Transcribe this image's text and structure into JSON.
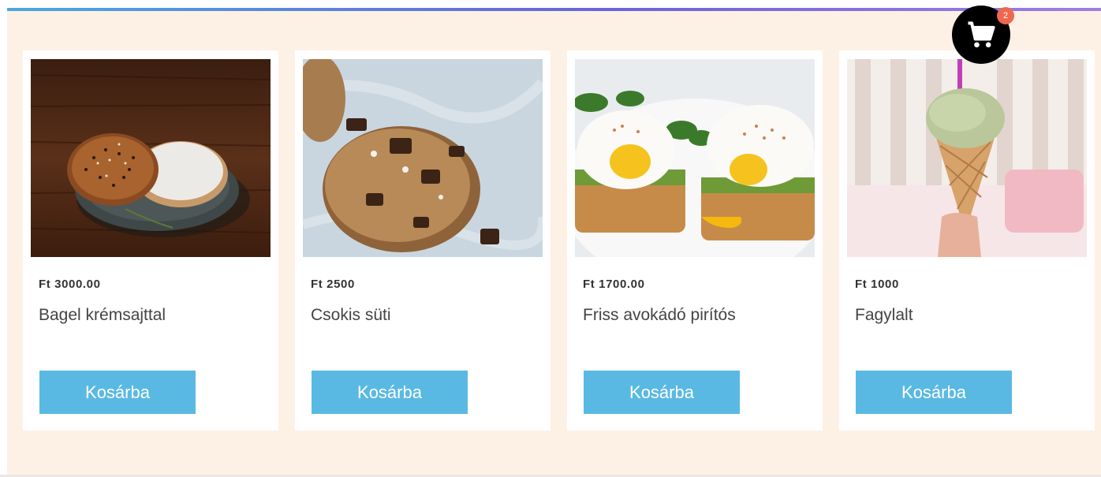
{
  "cart": {
    "count": "2",
    "icon": "shopping-cart-icon"
  },
  "products": [
    {
      "price": "Ft 3000.00",
      "name": "Bagel krémsajttal",
      "button": "Kosárba",
      "image": "bagel-photo"
    },
    {
      "price": "Ft 2500",
      "name": "Csokis süti",
      "button": "Kosárba",
      "image": "cookie-photo"
    },
    {
      "price": "Ft 1700.00",
      "name": "Friss avokádó pirítós",
      "button": "Kosárba",
      "image": "avocado-toast-photo"
    },
    {
      "price": "Ft 1000",
      "name": "Fagylalt",
      "button": "Kosárba",
      "image": "ice-cream-photo"
    }
  ],
  "colors": {
    "background": "#fdf1e6",
    "button": "#5ab9e3",
    "badge": "#f0674f",
    "accent_line": "#6a63d8"
  }
}
